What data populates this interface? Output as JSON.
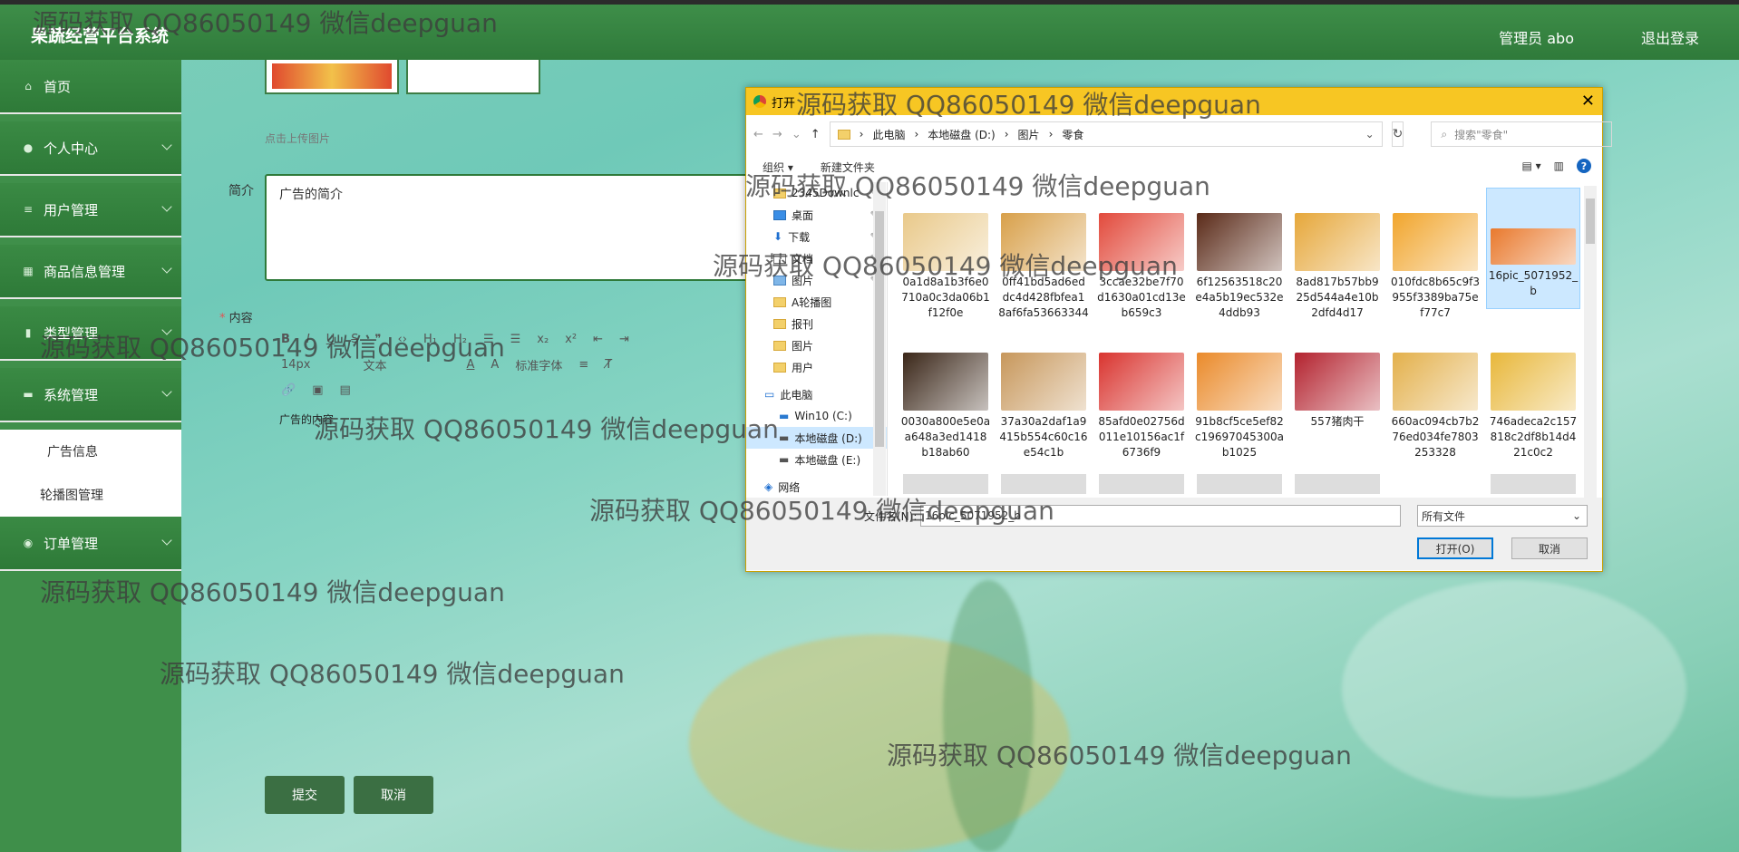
{
  "header": {
    "brand": "果蔬经营平台系统",
    "user_label": "管理员 abo",
    "logout_label": "退出登录"
  },
  "sidebar": {
    "items": [
      {
        "label": "首页",
        "icon": "home-icon"
      },
      {
        "label": "个人中心",
        "icon": "user-icon"
      },
      {
        "label": "用户管理",
        "icon": "list-icon"
      },
      {
        "label": "商品信息管理",
        "icon": "grid-icon"
      },
      {
        "label": "类型管理",
        "icon": "bar-chart-icon"
      },
      {
        "label": "系统管理",
        "icon": "monitor-icon"
      }
    ],
    "submenu": [
      {
        "label": "广告信息"
      },
      {
        "label": "轮播图管理"
      }
    ],
    "order": {
      "label": "订单管理",
      "icon": "location-icon"
    }
  },
  "form": {
    "upload_hint": "点击上传图片",
    "intro_label": "简介",
    "intro_value": "广告的简介",
    "content_label": "内容",
    "editor": {
      "font_size": "14px",
      "paragraph": "文本",
      "font_family": "标准字体",
      "content": "广告的内容"
    },
    "submit_label": "提交",
    "cancel_label": "取消"
  },
  "dialog": {
    "title": "打开",
    "breadcrumb": [
      "此电脑",
      "本地磁盘 (D:)",
      "图片",
      "零食"
    ],
    "search_placeholder": "搜索\"零食\"",
    "organize_label": "组织 ▾",
    "new_folder_label": "新建文件夹",
    "nav": [
      {
        "label": "2345Downlc",
        "pinned": true
      },
      {
        "label": "桌面",
        "pinned": true
      },
      {
        "label": "下载",
        "pinned": true
      },
      {
        "label": "文档",
        "pinned": true
      },
      {
        "label": "图片",
        "pinned": true
      },
      {
        "label": "A轮播图"
      },
      {
        "label": "报刊"
      },
      {
        "label": "图片"
      },
      {
        "label": "用户"
      }
    ],
    "drives": [
      {
        "label": "此电脑"
      },
      {
        "label": "Win10 (C:)"
      },
      {
        "label": "本地磁盘 (D:)"
      },
      {
        "label": "本地磁盘 (E:)"
      },
      {
        "label": "网络"
      }
    ],
    "files": [
      {
        "name": "0a1d8a1b3f6e0\n710a0c3da06b1\nf12f0e",
        "color": "#e9c98a"
      },
      {
        "name": "0ff41bd5ad6ed\ndc4d428fbfea1\n8af6fa53663344",
        "color": "#d8a04a"
      },
      {
        "name": "3ccae32be7f70\nd1630a01cd13e\nb659c3",
        "color": "#e24a3c"
      },
      {
        "name": "6f12563518c20\ne4a5b19ec532e\n4ddb93",
        "color": "#5a2a18"
      },
      {
        "name": "8ad817b57bb9\n25d544a4e10b\n2dfd4d17",
        "color": "#e6a73a"
      },
      {
        "name": "010fdc8b65c9f3\n955f3389ba75e\nf77c7",
        "color": "#f1a52c"
      },
      {
        "name": "16pic_5071952_\nb",
        "color": "#e9792d"
      },
      {
        "name": "0030a800e5e0a\na648a3ed1418\nb18ab60",
        "color": "#3a2618"
      },
      {
        "name": "37a30a2daf1a9\n415b554c60c16\ne54c1b",
        "color": "#c7975b"
      },
      {
        "name": "85afd0e02756d\n011e10156ac1f\n6736f9",
        "color": "#d9342f"
      },
      {
        "name": "91b8cf5ce5ef82\nc19697045300a\nb1025",
        "color": "#ea8a2a"
      },
      {
        "name": "557猪肉干",
        "color": "#b3222e"
      },
      {
        "name": "660ac094cb7b2\n76ed034fe7803\n253328",
        "color": "#e3b04b"
      },
      {
        "name": "746adeca2c157\n818c2df8b14d4\n21c0c2",
        "color": "#e8b73a"
      }
    ],
    "filename_label": "文件名(N):",
    "filename_value": "16pic_5071952_b",
    "filetype_value": "所有文件",
    "open_label": "打开(O)",
    "cancel_label": "取消"
  },
  "watermark": "源码获取 QQ86050149 微信deepguan"
}
